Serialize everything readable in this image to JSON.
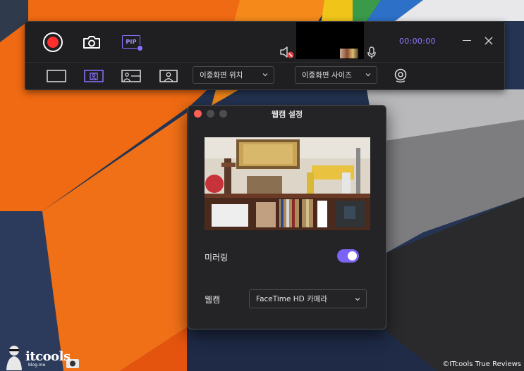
{
  "toolbar": {
    "timer": "00:00:00",
    "pip_label": "PIP",
    "dual_position_label": "이중화면 위치",
    "dual_size_label": "이중화면 사이즈"
  },
  "webcam_window": {
    "title": "웹캠 설정",
    "mirroring_label": "미러링",
    "mirroring_on": true,
    "webcam_label": "웹캠",
    "webcam_value": "FaceTime HD 카메라"
  },
  "watermark": {
    "brand": "itcools",
    "sub": "blog.me",
    "copyright": "©ITcools True Reviews"
  },
  "colors": {
    "accent": "#7b63f5",
    "record": "#ff2e2e",
    "toolbar_bg": "#1f1f21",
    "window_bg": "#242426"
  },
  "icons": [
    "record-icon",
    "camera-icon",
    "pip-icon",
    "mic-muted-icon",
    "mic-icon",
    "minimize-icon",
    "close-icon",
    "layout-full-icon",
    "layout-pip-icon",
    "layout-side-icon",
    "layout-person-icon",
    "chevron-down-icon",
    "webcam-icon"
  ]
}
